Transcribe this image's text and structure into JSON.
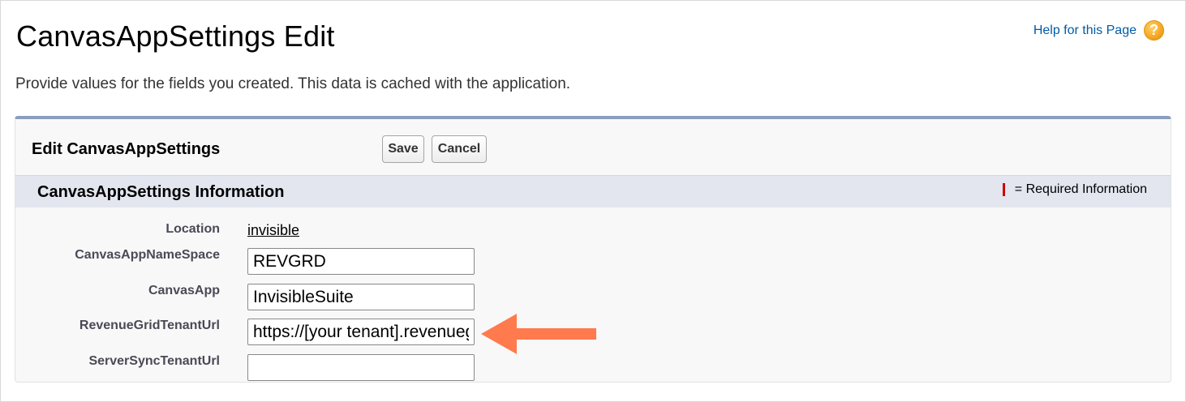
{
  "page": {
    "title": "CanvasAppSettings Edit",
    "help_link": "Help for this Page",
    "help_icon": "question-mark-icon",
    "help_glyph": "?",
    "description": "Provide values for the fields you created. This data is cached with the application."
  },
  "panel": {
    "title": "Edit CanvasAppSettings",
    "save_label": "Save",
    "cancel_label": "Cancel",
    "accent_color": "#8a9ebe"
  },
  "section": {
    "title": "CanvasAppSettings Information",
    "required_legend": "= Required Information",
    "required_color": "#cc0000"
  },
  "fields": {
    "location": {
      "label": "Location",
      "value": "invisible"
    },
    "namespace": {
      "label": "CanvasAppNameSpace",
      "value": "REVGRD"
    },
    "canvas_app": {
      "label": "CanvasApp",
      "value": "InvisibleSuite"
    },
    "revenue_grid_url": {
      "label": "RevenueGridTenantUrl",
      "value": "https://[your tenant].revenuegrid"
    },
    "server_sync_url": {
      "label": "ServerSyncTenantUrl",
      "value": ""
    }
  },
  "annotation": {
    "arrow_icon": "left-arrow-icon",
    "arrow_color": "#ff7a4d"
  }
}
